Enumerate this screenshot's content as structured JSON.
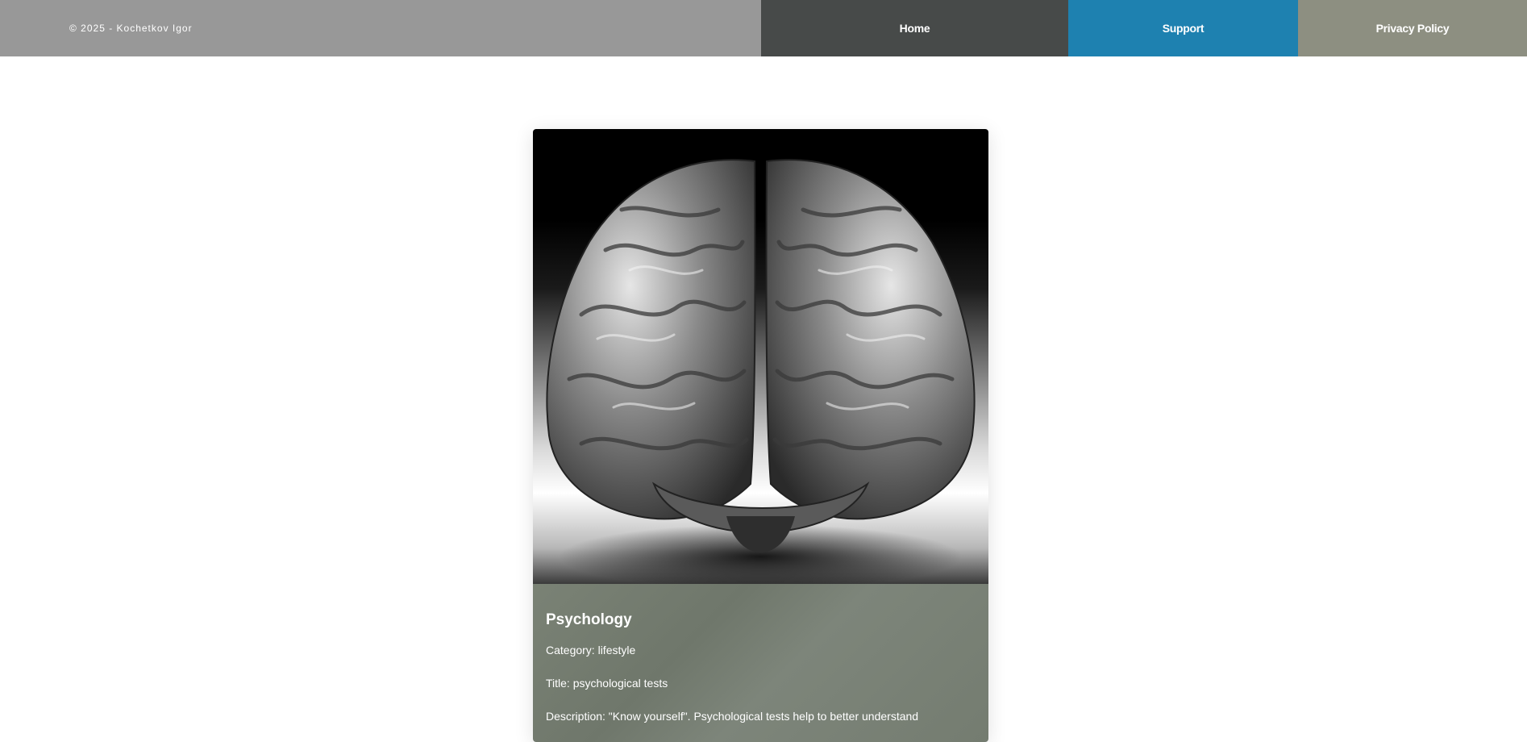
{
  "header": {
    "copyright": "© 2025 - Kochetkov Igor",
    "nav": [
      {
        "label": "Home",
        "color": "#474a49"
      },
      {
        "label": "Support",
        "color": "#1e81b0"
      },
      {
        "label": "Privacy Policy",
        "color": "#8d8f81"
      }
    ]
  },
  "card": {
    "image_icon": "brain-image",
    "title": "Psychology",
    "category": "Category: lifestyle",
    "subtitle": "Title: psychological tests",
    "description": "Description: \"Know yourself\". Psychological tests help to better understand"
  }
}
